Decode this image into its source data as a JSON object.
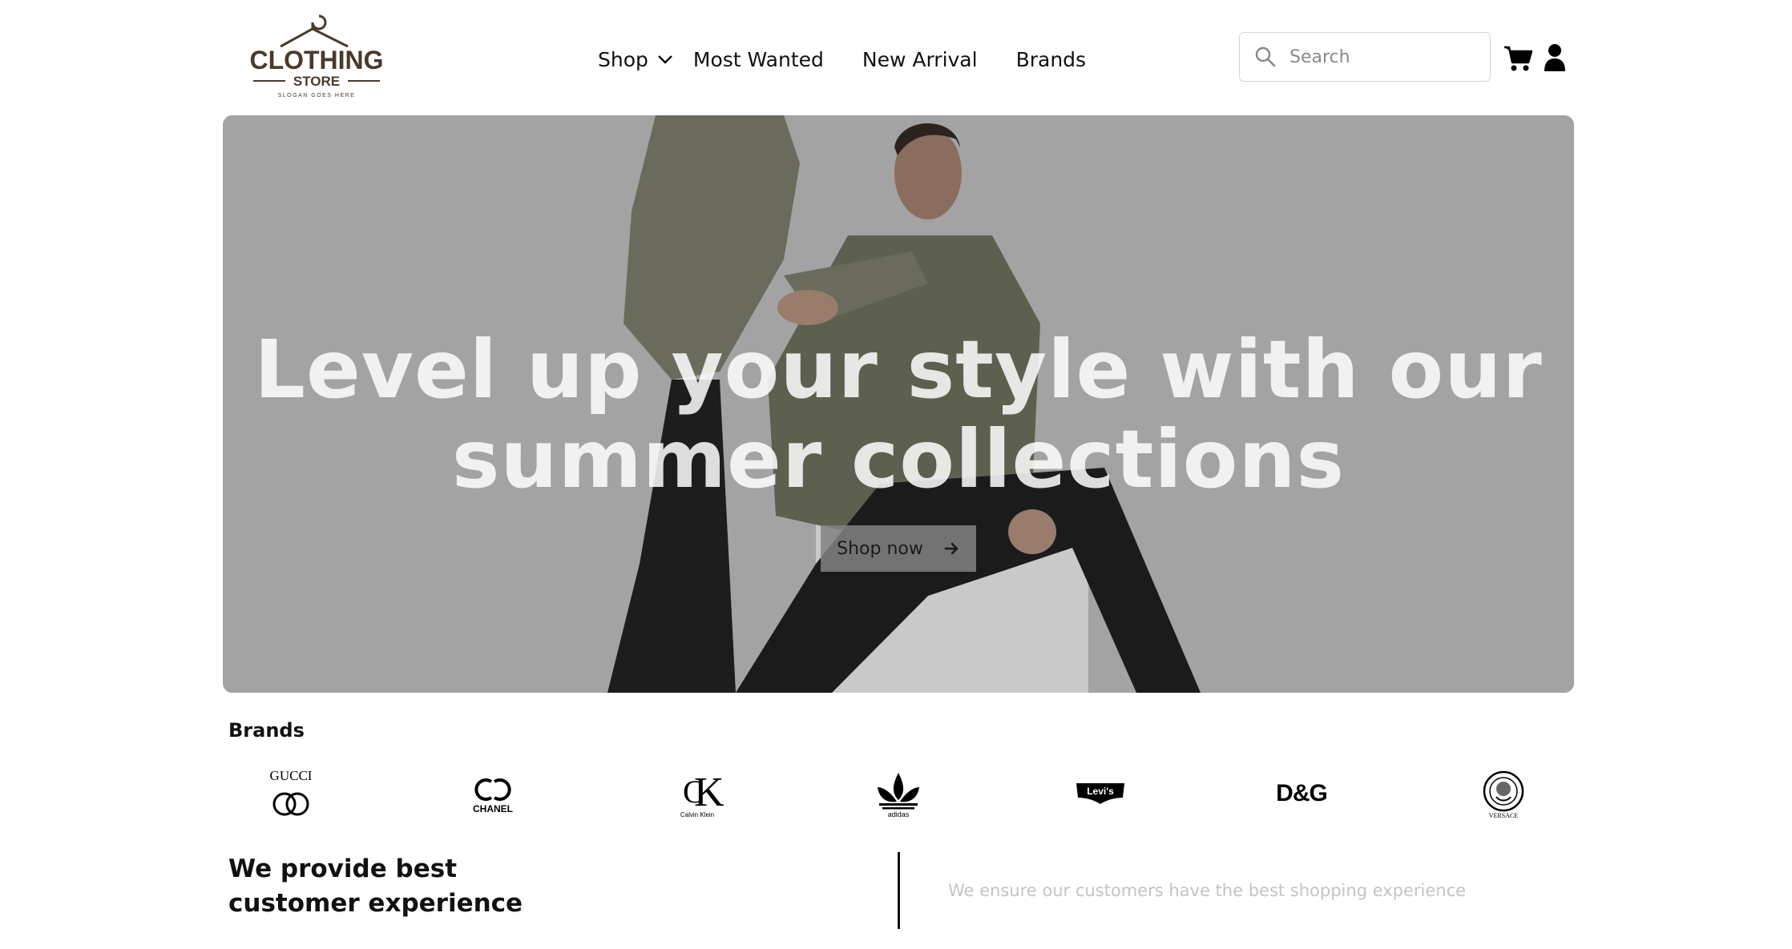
{
  "header": {
    "logo": {
      "name": "hanger-logo",
      "title": "CLOTHING",
      "subtitle": "STORE",
      "slogan": "SLOGAN GOES HERE",
      "color": "#4a3a2a"
    },
    "nav": {
      "shop_label": "Shop",
      "most_wanted_label": "Most Wanted",
      "new_arrival_label": "New Arrival",
      "brands_label": "Brands"
    },
    "search": {
      "placeholder": "Search",
      "value": ""
    },
    "icons": {
      "cart": "shopping-cart-icon",
      "user": "user-icon",
      "search": "search-icon",
      "chevron": "chevron-down-icon"
    }
  },
  "hero": {
    "title_line1": "Level up your style with our",
    "title_line2": "summer collections",
    "cta_label": "Shop now",
    "cta_icon": "arrow-right-icon",
    "background_color": "#a3a3a3"
  },
  "brands": {
    "title": "Brands",
    "items": [
      {
        "name": "GUCCI"
      },
      {
        "name": "CHANEL"
      },
      {
        "name": "Calvin Klein"
      },
      {
        "name": "adidas"
      },
      {
        "name": "Levi's"
      },
      {
        "name": "D&G"
      },
      {
        "name": "VERSACE"
      }
    ]
  },
  "experience": {
    "title_line1": "We provide best",
    "title_line2": "customer experience",
    "text": "We ensure our customers have the best shopping experience"
  }
}
